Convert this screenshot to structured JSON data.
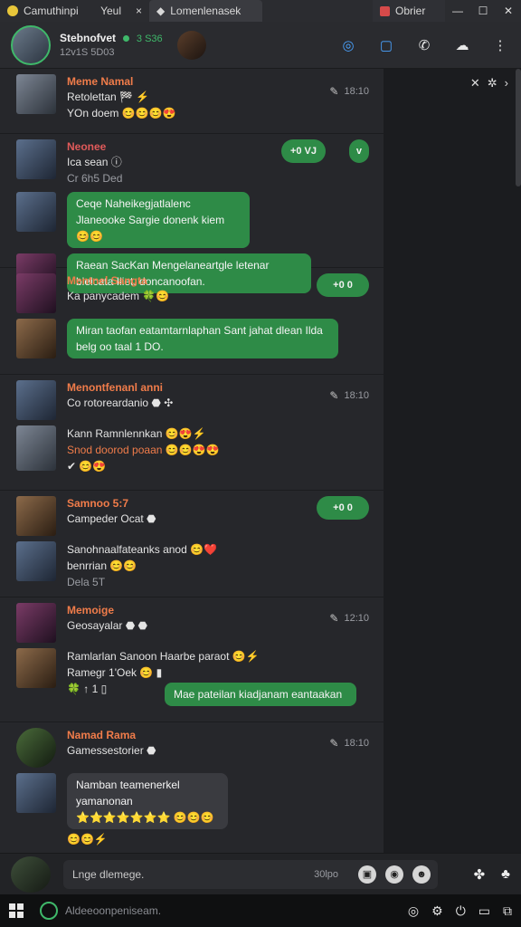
{
  "titlebar": {
    "tabs": [
      "Camuthinpi",
      "Yeul",
      "Lomenlenasek",
      "Obrier"
    ],
    "close_tab_glyph": "×"
  },
  "header": {
    "name": "Stebnofvet",
    "status_prefix": "3 S36",
    "status": "12v1S 5D03",
    "icons": [
      "compass-icon",
      "bookmark-icon",
      "phone-icon",
      "attach-icon",
      "more-icon"
    ]
  },
  "side_panel": {
    "controls": [
      "✕",
      "✲",
      "›"
    ]
  },
  "groups": [
    {
      "sender": "Meme Namal",
      "lines": [
        "Retolettan 🏁 ⚡",
        "YOn doem 😊😊😊😍"
      ],
      "time": "18:10"
    },
    {
      "sender": "Neonee",
      "lines": [
        "Ica sean ⓘ",
        "Cr 6h5 Ded"
      ],
      "pill": "+0 VJ",
      "pill2": "v",
      "bubbles": [
        "Ceqe Naheikegjatlalenc Jlaneooke Sargie donenk kiem 😊😊",
        "Raean SacKan Mengelaneartgle letenar blelcata Iliet. doncanoofan."
      ]
    },
    {
      "sender": "Mentnel Sangta",
      "lines": [
        "Ka panycadem 🍀😊"
      ],
      "pill": "+0 0",
      "bubbles": [
        "Miran taofan eatamtarnlaphan Sant jahat dlean Ilda belg oo taal 1 DO."
      ]
    },
    {
      "sender": "Menontfenanl anni",
      "lines": [
        "Co rotoreardanio ⬣ ✣"
      ],
      "time": "18:10",
      "second_lines": [
        "Kann Ramnlennkan 😊😍⚡",
        "Snod doorod poaan 😊😊😍😍",
        "✔ 😊😍"
      ]
    },
    {
      "sender": "Samnoo 5:7",
      "lines": [
        "Campeder Ocat ⬣"
      ],
      "pill": "+0 0",
      "second_lines": [
        "Sanohnaalfateanks anod 😊❤️",
        "benrrian 😊😊",
        "Dela 5T"
      ]
    },
    {
      "sender": "Memoige",
      "lines": [
        "Geosayalar ⬣ ⬣"
      ],
      "time": "12:10",
      "second_lines": [
        "Ramlarlan Sanoon Haarbe paraot 😊⚡",
        "Ramegr 1'Oek 😊 ▮",
        "🍀 ↑ 1 ▯"
      ],
      "bubbles": [
        "Mae pateilan kiadjanam eantaakan"
      ]
    },
    {
      "sender": "Namad Rama",
      "lines": [
        "Gamessestorier ⬣"
      ],
      "time": "18:10",
      "bubbles": [
        "Namban teamenerkel yamanonan ⭐⭐⭐⭐⭐⭐⭐ 😊😊😊"
      ],
      "tail": "😊😊⚡"
    }
  ],
  "composer": {
    "placeholder": "Lnge dlemege.",
    "counter": "30lpo"
  },
  "taskbar": {
    "search_text": "Aldeeoonpeniseam."
  }
}
